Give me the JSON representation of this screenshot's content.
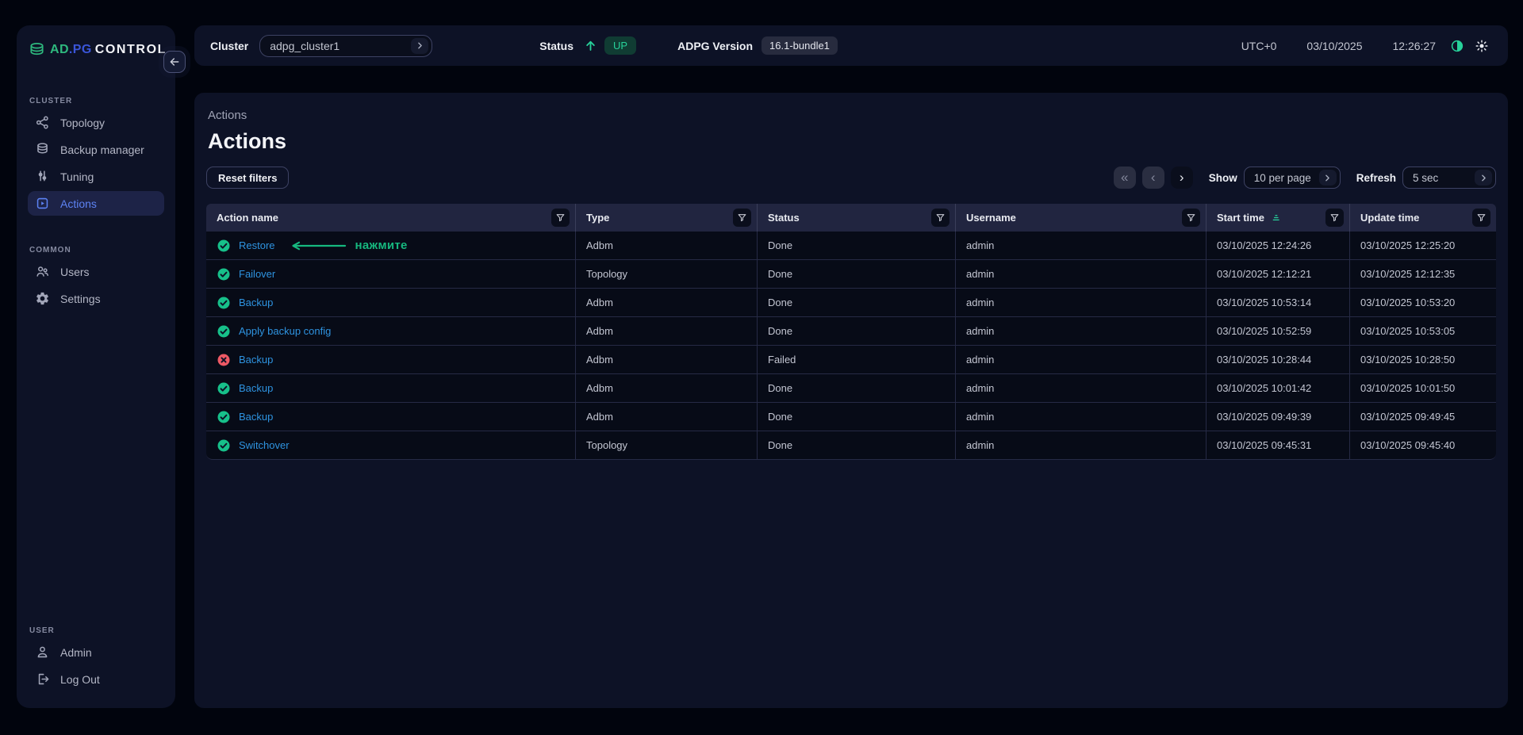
{
  "brand": {
    "part_green": "AD",
    "part_blue": ".PG",
    "part_white": "CONTROL"
  },
  "sidebar": {
    "sections": [
      {
        "label": "CLUSTER",
        "items": [
          {
            "label": "Topology",
            "icon": "topology-icon",
            "active": false
          },
          {
            "label": "Backup manager",
            "icon": "database-icon",
            "active": false
          },
          {
            "label": "Tuning",
            "icon": "tuning-icon",
            "active": false
          },
          {
            "label": "Actions",
            "icon": "actions-icon",
            "active": true
          }
        ]
      },
      {
        "label": "COMMON",
        "items": [
          {
            "label": "Users",
            "icon": "users-icon",
            "active": false
          },
          {
            "label": "Settings",
            "icon": "settings-icon",
            "active": false
          }
        ]
      },
      {
        "label": "USER",
        "items": [
          {
            "label": "Admin",
            "icon": "person-icon",
            "active": false
          },
          {
            "label": "Log Out",
            "icon": "logout-icon",
            "active": false
          }
        ]
      }
    ]
  },
  "topbar": {
    "cluster_label": "Cluster",
    "cluster_value": "adpg_cluster1",
    "status_label": "Status",
    "status_value": "UP",
    "version_label": "ADPG Version",
    "version_value": "16.1-bundle1",
    "timezone": "UTC+0",
    "date": "03/10/2025",
    "time": "12:26:27"
  },
  "main": {
    "breadcrumb": "Actions",
    "title": "Actions",
    "reset_filters_label": "Reset filters",
    "show_label": "Show",
    "per_page_value": "10 per page",
    "refresh_label": "Refresh",
    "refresh_value": "5 sec"
  },
  "table": {
    "columns": [
      "Action name",
      "Type",
      "Status",
      "Username",
      "Start time",
      "Update time"
    ],
    "sorted_column": "Start time",
    "rows": [
      {
        "result": "success",
        "action": "Restore",
        "type": "Adbm",
        "status": "Done",
        "username": "admin",
        "start_time": "03/10/2025 12:24:26",
        "update_time": "03/10/2025 12:25:20",
        "annotation": "нажмите"
      },
      {
        "result": "success",
        "action": "Failover",
        "type": "Topology",
        "status": "Done",
        "username": "admin",
        "start_time": "03/10/2025 12:12:21",
        "update_time": "03/10/2025 12:12:35",
        "annotation": ""
      },
      {
        "result": "success",
        "action": "Backup",
        "type": "Adbm",
        "status": "Done",
        "username": "admin",
        "start_time": "03/10/2025 10:53:14",
        "update_time": "03/10/2025 10:53:20",
        "annotation": ""
      },
      {
        "result": "success",
        "action": "Apply backup config",
        "type": "Adbm",
        "status": "Done",
        "username": "admin",
        "start_time": "03/10/2025 10:52:59",
        "update_time": "03/10/2025 10:53:05",
        "annotation": ""
      },
      {
        "result": "failed",
        "action": "Backup",
        "type": "Adbm",
        "status": "Failed",
        "username": "admin",
        "start_time": "03/10/2025 10:28:44",
        "update_time": "03/10/2025 10:28:50",
        "annotation": ""
      },
      {
        "result": "success",
        "action": "Backup",
        "type": "Adbm",
        "status": "Done",
        "username": "admin",
        "start_time": "03/10/2025 10:01:42",
        "update_time": "03/10/2025 10:01:50",
        "annotation": ""
      },
      {
        "result": "success",
        "action": "Backup",
        "type": "Adbm",
        "status": "Done",
        "username": "admin",
        "start_time": "03/10/2025 09:49:39",
        "update_time": "03/10/2025 09:49:45",
        "annotation": ""
      },
      {
        "result": "success",
        "action": "Switchover",
        "type": "Topology",
        "status": "Done",
        "username": "admin",
        "start_time": "03/10/2025 09:45:31",
        "update_time": "03/10/2025 09:45:40",
        "annotation": ""
      }
    ]
  },
  "colors": {
    "accent_green": "#17c08a",
    "annotation_green": "#16b87f",
    "link_blue": "#2e93e0",
    "active_blue": "#5d83f4",
    "fail_red": "#ee5965",
    "badge_up_bg": "#103c33",
    "badge_up_text": "#27d19a",
    "card_bg": "#0d1226",
    "row_bg": "#070b17",
    "header_bg": "#212540"
  }
}
